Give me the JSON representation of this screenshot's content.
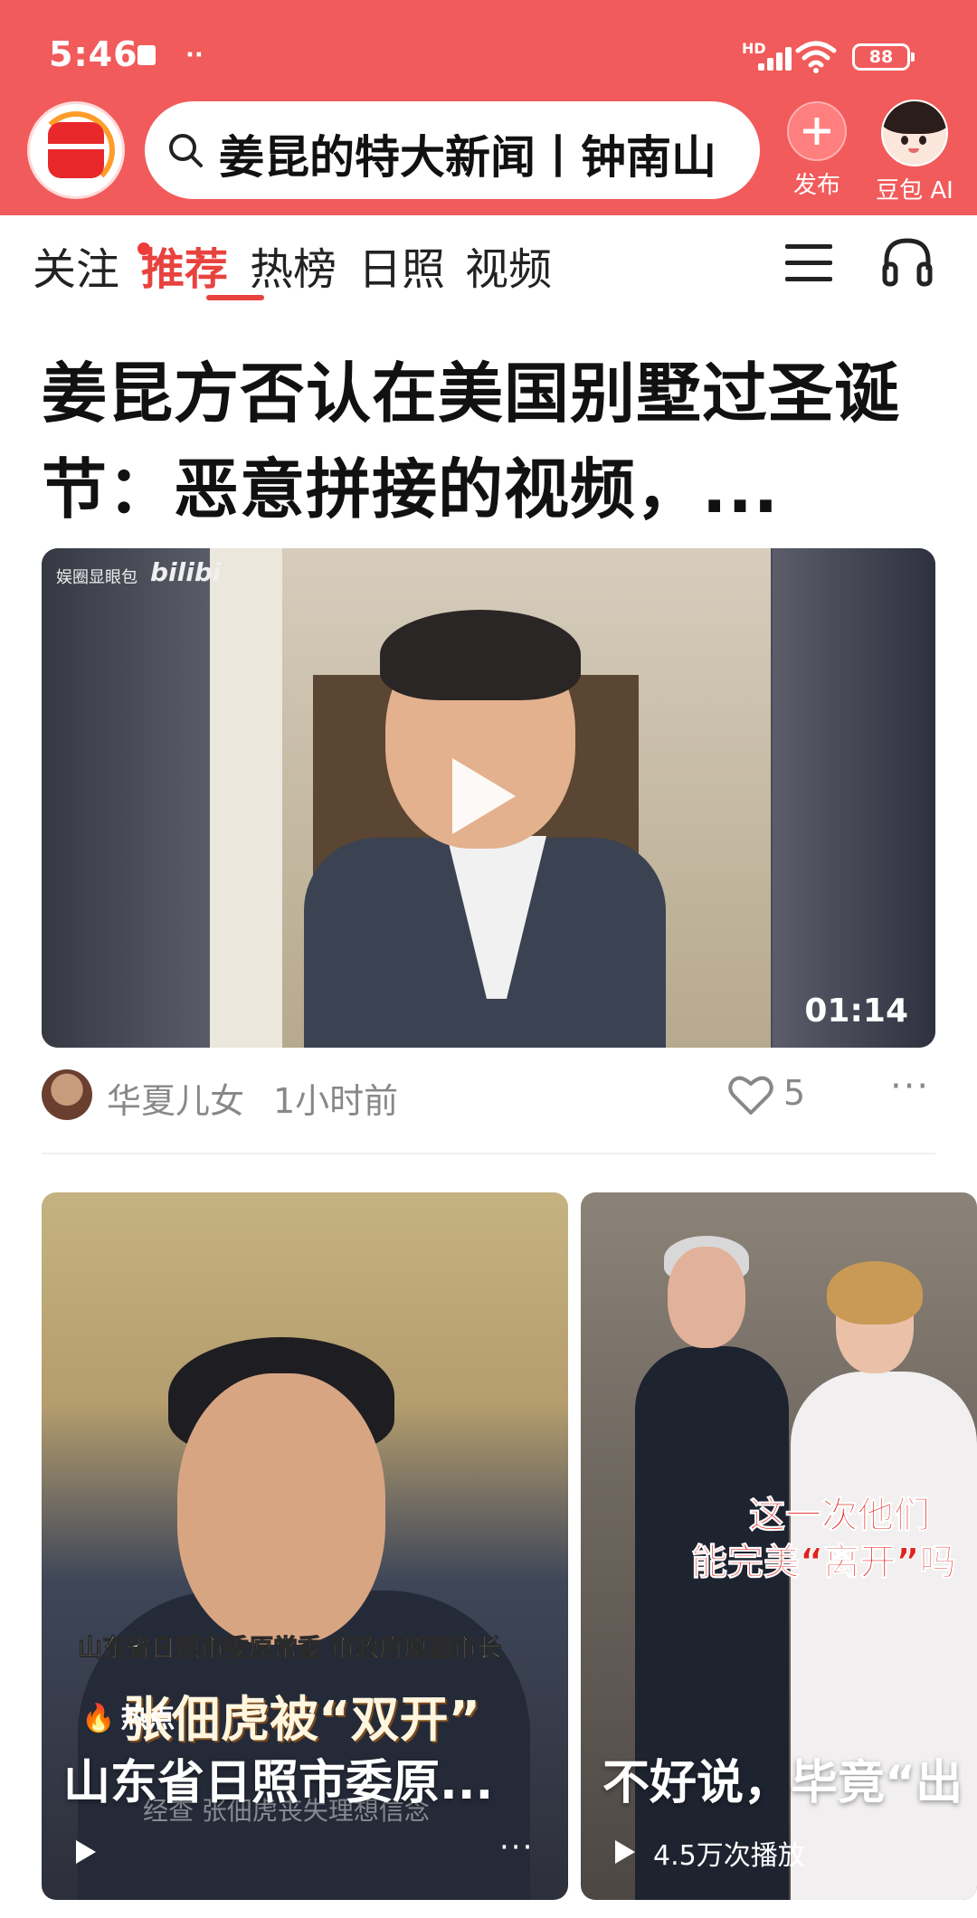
{
  "status_bar": {
    "time": "5:46",
    "dots": "··",
    "network": "HD",
    "battery": "88"
  },
  "header": {
    "search_text": "姜昆的特大新闻丨钟南山",
    "publish_label": "发布",
    "ai_label": "豆包 AI",
    "accent_color": "#f25b5b"
  },
  "tabs": [
    {
      "label": "关注",
      "active": false,
      "dot": true
    },
    {
      "label": "推荐",
      "active": true
    },
    {
      "label": "热榜",
      "active": false
    },
    {
      "label": "日照",
      "active": false
    },
    {
      "label": "视频",
      "active": false
    }
  ],
  "feed": {
    "main_article": {
      "title": "姜昆方否认在美国别墅过圣诞节：恶意拼接的视频，...",
      "video_watermark": "娱圈显眼包",
      "video_watermark_brand": "bilibi",
      "duration": "01:14",
      "author": "华夏儿女",
      "time": "1小时前",
      "likes": "5",
      "more": "···"
    },
    "cards": [
      {
        "overlay_line1": "山东省日照市委原常委 市政府原副市长",
        "overlay_line2": "张佃虎被“双开”",
        "badge": "热点",
        "title": "山东省日照市委原...",
        "sub_caption": "经查 张佃虎丧失理想信念",
        "more": "···"
      },
      {
        "overlay_line1": "这一次他们",
        "overlay_line2": "能完美“离开”吗",
        "title": "不好说，毕竟“出",
        "plays": "4.5万次播放"
      }
    ]
  }
}
